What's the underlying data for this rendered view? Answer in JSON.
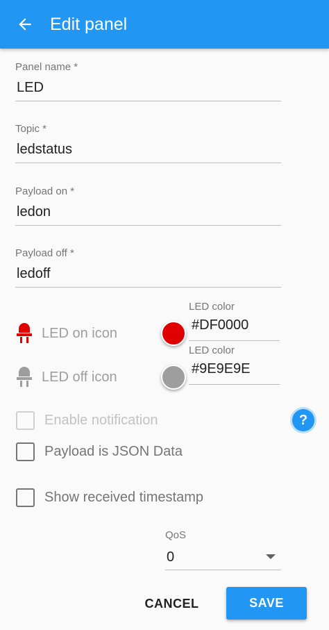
{
  "app_bar": {
    "title": "Edit panel",
    "color": "#2196F3"
  },
  "fields": {
    "panel_name": {
      "label": "Panel name *",
      "value": "LED"
    },
    "topic": {
      "label": "Topic *",
      "value": "ledstatus"
    },
    "payload_on": {
      "label": "Payload on *",
      "value": "ledon"
    },
    "payload_off": {
      "label": "Payload off *",
      "value": "ledoff"
    }
  },
  "led_on": {
    "label": "LED on icon",
    "icon": "led-icon",
    "color_label": "LED color",
    "color_value": "#DF0000",
    "swatch_color": "#DF0000"
  },
  "led_off": {
    "label": "LED off icon",
    "icon": "led-icon",
    "color_label": "LED color",
    "color_value": "#9E9E9E",
    "swatch_color": "#9E9E9E"
  },
  "options": {
    "enable_notification": {
      "label": "Enable notification",
      "checked": false,
      "disabled": true
    },
    "payload_json": {
      "label": "Payload is JSON Data",
      "checked": false
    },
    "show_timestamp": {
      "label": "Show received timestamp",
      "checked": false
    },
    "help_icon": "help-icon"
  },
  "qos": {
    "label": "QoS",
    "value": "0"
  },
  "actions": {
    "cancel": "CANCEL",
    "save": "SAVE"
  }
}
